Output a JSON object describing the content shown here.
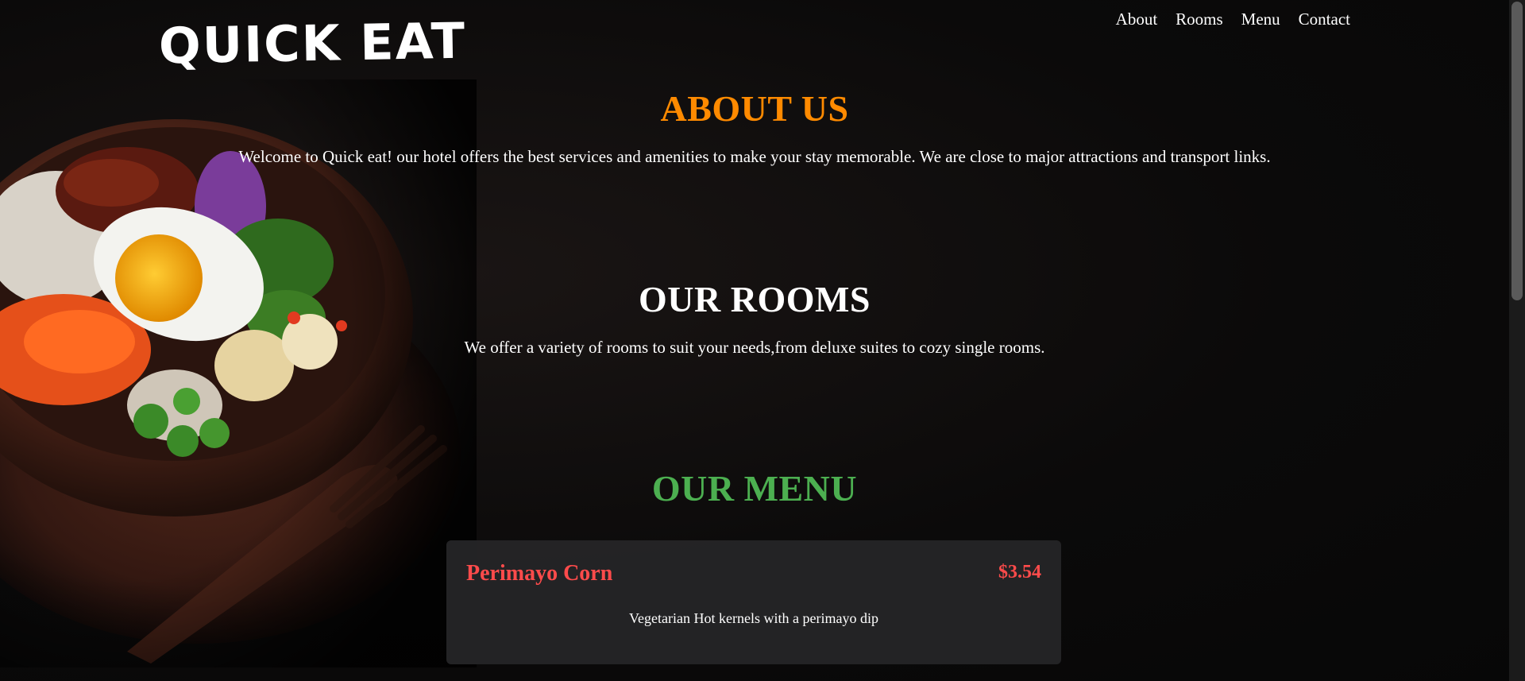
{
  "header": {
    "logo": "QUICK EAT",
    "nav": [
      "About",
      "Rooms",
      "Menu",
      "Contact"
    ]
  },
  "about": {
    "title": "ABOUT US",
    "text": "Welcome to Quick eat! our hotel offers the best services and amenities to make your stay memorable. We are close to major attractions and transport links."
  },
  "rooms": {
    "title": "OUR ROOMS",
    "text": "We offer a variety of rooms to suit your needs,from deluxe suites to cozy single rooms."
  },
  "menu": {
    "title": "OUR MENU",
    "items": [
      {
        "name": "Perimayo Corn",
        "price": "$3.54",
        "description": "Vegetarian Hot kernels with a perimayo dip"
      }
    ]
  },
  "colors": {
    "about_title": "#ff8a00",
    "menu_title": "#4caf50",
    "item_accent": "#ff4b4b"
  }
}
